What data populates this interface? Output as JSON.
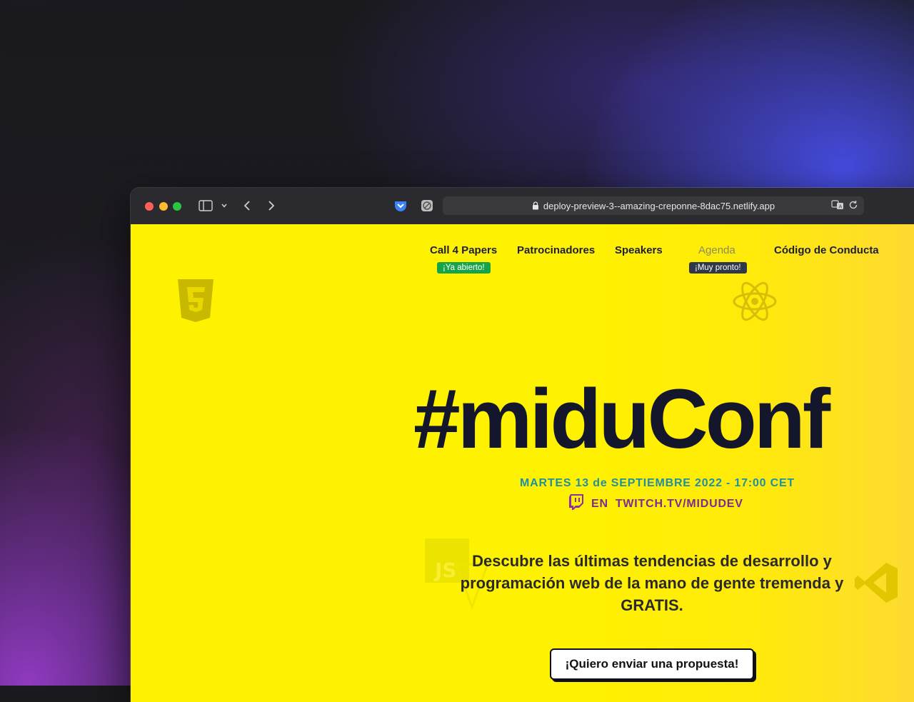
{
  "browser": {
    "url": "deploy-preview-3--amazing-creponne-8dac75.netlify.app"
  },
  "nav": {
    "items": [
      {
        "label": "Call 4 Papers",
        "badge": "¡Ya abierto!"
      },
      {
        "label": "Patrocinadores"
      },
      {
        "label": "Speakers"
      },
      {
        "label": "Agenda",
        "badge": "¡Muy pronto!"
      },
      {
        "label": "Código de Conducta"
      }
    ]
  },
  "hero": {
    "title": "#miduConf",
    "date": "MARTES 13 de SEPTIEMBRE 2022 - 17:00 CET",
    "twitch_prefix": "EN",
    "twitch_link": "TWITCH.TV/MIDUDEV",
    "description": "Descubre las últimas tendencias de desarrollo y programación web de la mano de gente tremenda y GRATIS.",
    "cta_label": "¡Quiero enviar una propuesta!"
  },
  "icons": {
    "html5": "html5-logo-icon",
    "react": "react-logo-icon",
    "js": "javascript-logo-icon",
    "vscode": "vscode-logo-icon",
    "twitch": "twitch-icon"
  },
  "colors": {
    "page_bg": "#fff200",
    "title": "#14172b",
    "date": "#1f8fa2",
    "twitch": "#7c2b94",
    "badge_open": "#16a34a",
    "badge_soon": "#2f3848"
  }
}
